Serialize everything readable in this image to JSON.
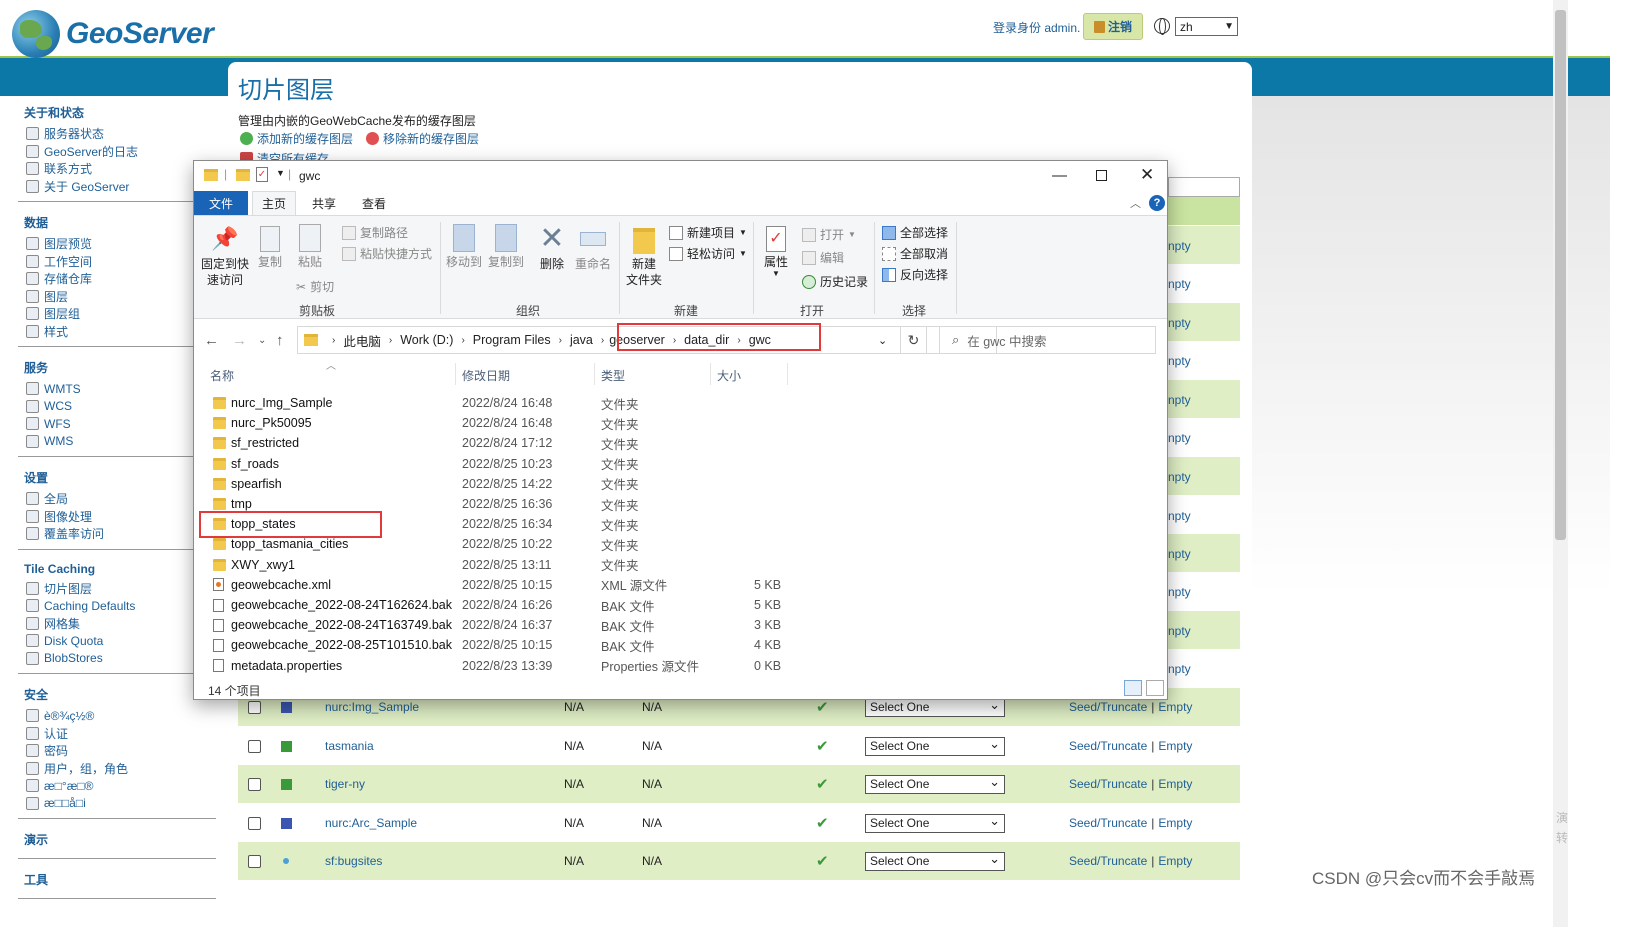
{
  "header": {
    "logo_text": "GeoServer",
    "login_info": "登录身份 admin.",
    "logout_label": "注销",
    "language": "zh"
  },
  "sidebar": {
    "sections": [
      {
        "title": "关于和状态",
        "items": [
          "服务器状态",
          "GeoServer的日志",
          "联系方式",
          "关于 GeoServer"
        ]
      },
      {
        "title": "数据",
        "items": [
          "图层预览",
          "工作空间",
          "存储仓库",
          "图层",
          "图层组",
          "样式"
        ]
      },
      {
        "title": "服务",
        "items": [
          "WMTS",
          "WCS",
          "WFS",
          "WMS"
        ]
      },
      {
        "title": "设置",
        "items": [
          "全局",
          "图像处理",
          "覆盖率访问"
        ]
      },
      {
        "title": "Tile Caching",
        "items": [
          "切片图层",
          "Caching Defaults",
          "网格集",
          "Disk Quota",
          "BlobStores"
        ]
      },
      {
        "title": "安全",
        "items": [
          "è®¾ç½®",
          "认证",
          "密码",
          "用户，组，角色",
          "æ□°æ□®",
          "æ□□å□i"
        ]
      },
      {
        "title": "演示",
        "items": []
      },
      {
        "title": "工具",
        "items": []
      }
    ]
  },
  "main": {
    "title": "切片图层",
    "description": "管理由内嵌的GeoWebCache发布的缓存图层",
    "add_label": "添加新的缓存图层",
    "remove_label": "移除新的缓存图层",
    "clear_label": "清空所有缓存",
    "rows": [
      {
        "name": "nurc:Img_Sample",
        "c1": "N/A",
        "c2": "N/A",
        "select": "Select One",
        "seed": "Seed/Truncate",
        "sep": "|",
        "empty": "Empty"
      },
      {
        "name": "tasmania",
        "c1": "N/A",
        "c2": "N/A",
        "select": "Select One",
        "seed": "Seed/Truncate",
        "sep": "|",
        "empty": "Empty"
      },
      {
        "name": "tiger-ny",
        "c1": "N/A",
        "c2": "N/A",
        "select": "Select One",
        "seed": "Seed/Truncate",
        "sep": "|",
        "empty": "Empty"
      },
      {
        "name": "nurc:Arc_Sample",
        "c1": "N/A",
        "c2": "N/A",
        "select": "Select One",
        "seed": "Seed/Truncate",
        "sep": "|",
        "empty": "Empty"
      },
      {
        "name": "sf:bugsites",
        "c1": "N/A",
        "c2": "N/A",
        "select": "Select One",
        "seed": "Seed/Truncate",
        "sep": "|",
        "empty": "Empty"
      }
    ],
    "hidden_row_fragment": "npty"
  },
  "explorer": {
    "title": "gwc",
    "tabs": {
      "file": "文件",
      "home": "主页",
      "share": "共享",
      "view": "查看"
    },
    "ribbon": {
      "pin": "固定到快\n速访问",
      "copy": "复制",
      "paste": "粘贴",
      "copy_path": "复制路径",
      "paste_shortcut": "粘贴快捷方式",
      "cut": "剪切",
      "clipboard_group": "剪贴板",
      "move_to": "移动到",
      "copy_to": "复制到",
      "delete": "删除",
      "rename": "重命名",
      "organize_group": "组织",
      "new_folder": "新建\n文件夹",
      "new_item": "新建项目",
      "easy_access": "轻松访问",
      "new_group": "新建",
      "properties": "属性",
      "open": "打开",
      "edit": "编辑",
      "history": "历史记录",
      "open_group": "打开",
      "select_all": "全部选择",
      "select_none": "全部取消",
      "invert_selection": "反向选择",
      "select_group": "选择"
    },
    "breadcrumb": [
      "此电脑",
      "Work (D:)",
      "Program Files",
      "java",
      "geoserver",
      "data_dir",
      "gwc"
    ],
    "search_placeholder": "在 gwc 中搜索",
    "columns": {
      "name": "名称",
      "date": "修改日期",
      "type": "类型",
      "size": "大小"
    },
    "files": [
      {
        "name": "nurc_Img_Sample",
        "date": "2022/8/24 16:48",
        "type": "文件夹",
        "size": "",
        "kind": "folder"
      },
      {
        "name": "nurc_Pk50095",
        "date": "2022/8/24 16:48",
        "type": "文件夹",
        "size": "",
        "kind": "folder"
      },
      {
        "name": "sf_restricted",
        "date": "2022/8/24 17:12",
        "type": "文件夹",
        "size": "",
        "kind": "folder"
      },
      {
        "name": "sf_roads",
        "date": "2022/8/25 10:23",
        "type": "文件夹",
        "size": "",
        "kind": "folder"
      },
      {
        "name": "spearfish",
        "date": "2022/8/25 14:22",
        "type": "文件夹",
        "size": "",
        "kind": "folder"
      },
      {
        "name": "tmp",
        "date": "2022/8/25 16:36",
        "type": "文件夹",
        "size": "",
        "kind": "folder"
      },
      {
        "name": "topp_states",
        "date": "2022/8/25 16:34",
        "type": "文件夹",
        "size": "",
        "kind": "folder"
      },
      {
        "name": "topp_tasmania_cities",
        "date": "2022/8/25 10:22",
        "type": "文件夹",
        "size": "",
        "kind": "folder"
      },
      {
        "name": "XWY_xwy1",
        "date": "2022/8/25 13:11",
        "type": "文件夹",
        "size": "",
        "kind": "folder"
      },
      {
        "name": "geowebcache.xml",
        "date": "2022/8/25 10:15",
        "type": "XML 源文件",
        "size": "5 KB",
        "kind": "xml"
      },
      {
        "name": "geowebcache_2022-08-24T162624.bak",
        "date": "2022/8/24 16:26",
        "type": "BAK 文件",
        "size": "5 KB",
        "kind": "doc"
      },
      {
        "name": "geowebcache_2022-08-24T163749.bak",
        "date": "2022/8/24 16:37",
        "type": "BAK 文件",
        "size": "3 KB",
        "kind": "doc"
      },
      {
        "name": "geowebcache_2022-08-25T101510.bak",
        "date": "2022/8/25 10:15",
        "type": "BAK 文件",
        "size": "4 KB",
        "kind": "doc"
      },
      {
        "name": "metadata.properties",
        "date": "2022/8/23 13:39",
        "type": "Properties 源文件",
        "size": "0 KB",
        "kind": "doc"
      }
    ],
    "status": "14 个项目"
  },
  "watermark": "CSDN @只会cv而不会手敲焉",
  "edge_text": "演\n转"
}
